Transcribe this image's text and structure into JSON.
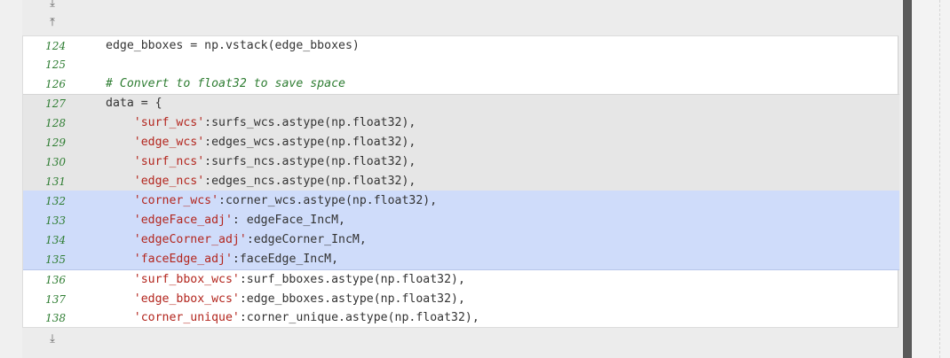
{
  "expanders": {
    "top_down_icon": "expand-down-icon",
    "top_up_icon": "expand-up-icon",
    "bottom_down_icon": "expand-down-icon"
  },
  "lines": [
    {
      "num": "124",
      "band": "white",
      "segments": [
        {
          "t": "plain",
          "v": "edge_bboxes = np.vstack(edge_bboxes)"
        }
      ]
    },
    {
      "num": "125",
      "band": "white",
      "segments": []
    },
    {
      "num": "126",
      "band": "white",
      "segments": [
        {
          "t": "comment",
          "v": "# Convert to float32 to save space"
        }
      ]
    },
    {
      "num": "127",
      "band": "grey",
      "segments": [
        {
          "t": "plain",
          "v": "data = {"
        }
      ]
    },
    {
      "num": "128",
      "band": "grey",
      "segments": [
        {
          "t": "plain",
          "v": "    "
        },
        {
          "t": "string",
          "v": "'surf_wcs'"
        },
        {
          "t": "plain",
          "v": ":surfs_wcs.astype(np.float32),"
        }
      ]
    },
    {
      "num": "129",
      "band": "grey",
      "segments": [
        {
          "t": "plain",
          "v": "    "
        },
        {
          "t": "string",
          "v": "'edge_wcs'"
        },
        {
          "t": "plain",
          "v": ":edges_wcs.astype(np.float32),"
        }
      ]
    },
    {
      "num": "130",
      "band": "grey",
      "segments": [
        {
          "t": "plain",
          "v": "    "
        },
        {
          "t": "string",
          "v": "'surf_ncs'"
        },
        {
          "t": "plain",
          "v": ":surfs_ncs.astype(np.float32),"
        }
      ]
    },
    {
      "num": "131",
      "band": "grey",
      "segments": [
        {
          "t": "plain",
          "v": "    "
        },
        {
          "t": "string",
          "v": "'edge_ncs'"
        },
        {
          "t": "plain",
          "v": ":edges_ncs.astype(np.float32),"
        }
      ]
    },
    {
      "num": "132",
      "band": "blue",
      "segments": [
        {
          "t": "plain",
          "v": "    "
        },
        {
          "t": "string",
          "v": "'corner_wcs'"
        },
        {
          "t": "plain",
          "v": ":corner_wcs.astype(np.float32),"
        }
      ]
    },
    {
      "num": "133",
      "band": "blue",
      "segments": [
        {
          "t": "plain",
          "v": "    "
        },
        {
          "t": "string",
          "v": "'edgeFace_adj'"
        },
        {
          "t": "plain",
          "v": ": edgeFace_IncM,"
        }
      ]
    },
    {
      "num": "134",
      "band": "blue",
      "segments": [
        {
          "t": "plain",
          "v": "    "
        },
        {
          "t": "string",
          "v": "'edgeCorner_adj'"
        },
        {
          "t": "plain",
          "v": ":edgeCorner_IncM,"
        }
      ]
    },
    {
      "num": "135",
      "band": "blue",
      "segments": [
        {
          "t": "plain",
          "v": "    "
        },
        {
          "t": "string",
          "v": "'faceEdge_adj'"
        },
        {
          "t": "plain",
          "v": ":faceEdge_IncM,"
        }
      ]
    },
    {
      "num": "136",
      "band": "white",
      "segments": [
        {
          "t": "plain",
          "v": "    "
        },
        {
          "t": "string",
          "v": "'surf_bbox_wcs'"
        },
        {
          "t": "plain",
          "v": ":surf_bboxes.astype(np.float32),"
        }
      ]
    },
    {
      "num": "137",
      "band": "white",
      "segments": [
        {
          "t": "plain",
          "v": "    "
        },
        {
          "t": "string",
          "v": "'edge_bbox_wcs'"
        },
        {
          "t": "plain",
          "v": ":edge_bboxes.astype(np.float32),"
        }
      ]
    },
    {
      "num": "138",
      "band": "white",
      "segments": [
        {
          "t": "plain",
          "v": "    "
        },
        {
          "t": "string",
          "v": "'corner_unique'"
        },
        {
          "t": "plain",
          "v": ":corner_unique.astype(np.float32),"
        }
      ]
    }
  ],
  "colors": {
    "line_number": "#2e7d32",
    "string": "#b3261e",
    "comment": "#2e7d32",
    "highlight_grey": "#e6e6e6",
    "highlight_blue": "#cfdcfa"
  }
}
